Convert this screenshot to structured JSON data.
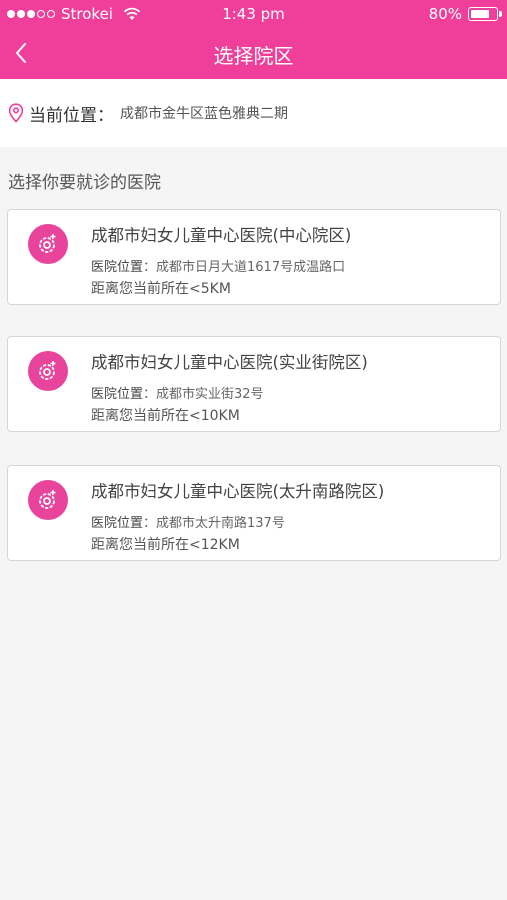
{
  "status_bar": {
    "carrier": "Strokei",
    "time": "1:43 pm",
    "battery": "80%",
    "battery_level": 0.8
  },
  "nav": {
    "title": "选择院区",
    "back_icon": "chevron-left-icon"
  },
  "location": {
    "label": "当前位置：",
    "value": "成都市金牛区蓝色雅典二期",
    "icon": "map-pin-icon"
  },
  "section_title": "选择你要就诊的医院",
  "hospitals": [
    {
      "name": "成都市妇女儿童中心医院(中心院区)",
      "address_label": "医院位置",
      "address": "：成都市日月大道1617号成温路口",
      "distance": "距离您当前所在<5KM"
    },
    {
      "name": "成都市妇女儿童中心医院(实业街院区)",
      "address_label": "医院位置",
      "address": "：成都市实业街32号",
      "distance": "距离您当前所在<10KM"
    },
    {
      "name": "成都市妇女儿童中心医院(太升南路院区)",
      "address_label": "医院位置",
      "address": "：成都市太升南路137号",
      "distance": "距离您当前所在<12KM"
    }
  ],
  "colors": {
    "brand": "#f03f9a",
    "icon_bg": "#e8449c"
  }
}
